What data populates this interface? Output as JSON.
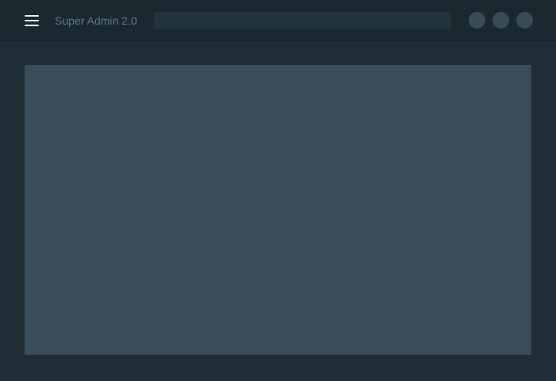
{
  "header": {
    "app_title": "Super Admin 2.0",
    "menu_icon": "hamburger-menu-icon",
    "search": {
      "value": "",
      "placeholder": ""
    },
    "action_buttons": [
      {
        "icon": "circle-button-icon"
      },
      {
        "icon": "circle-button-icon"
      },
      {
        "icon": "circle-button-icon"
      }
    ]
  },
  "main": {
    "content_panel_text": ""
  },
  "colors": {
    "background": "#1e2d36",
    "topbar": "#1a2830",
    "panel": "#394d5a",
    "title_text": "#5f7a87",
    "search_field": "#23333c",
    "icon_button": "#3a4c57",
    "menu_icon": "#e8eef2"
  }
}
